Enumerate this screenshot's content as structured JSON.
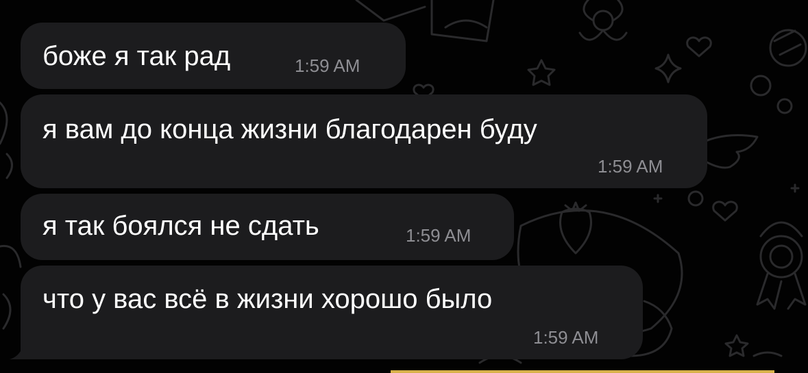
{
  "chat": {
    "messages": [
      {
        "text": "боже я так рад",
        "time": "1:59 AM"
      },
      {
        "text": "я вам до конца жизни благодарен буду",
        "time": "1:59 AM"
      },
      {
        "text": "я так боялся не сдать",
        "time": "1:59 AM"
      },
      {
        "text": "что у вас всё в жизни хорошо было",
        "time": "1:59 AM"
      }
    ]
  },
  "colors": {
    "background": "#000000",
    "bubble": "#1c1c1e",
    "text": "#ffffff",
    "time": "#8e8e93",
    "doodle": "#2a2a2c",
    "accent_bar": "#d8b24a"
  },
  "icons": [
    "star-doodle",
    "heart-doodle",
    "flower-doodle",
    "wing-doodle",
    "strawberry-doodle",
    "cake-doodle",
    "medal-doodle"
  ]
}
